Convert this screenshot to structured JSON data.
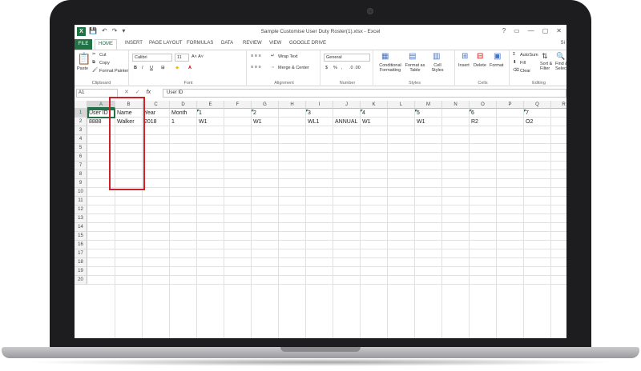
{
  "window": {
    "title": "Sample Customise User Duty Roster(1).xlsx - Excel",
    "app_icon": "X",
    "qat_icons": [
      "save-icon",
      "undo-icon",
      "redo-icon",
      "customize-icon"
    ],
    "controls": [
      "?",
      "▭",
      "—",
      "▢",
      "✕"
    ],
    "sign_in": "Si"
  },
  "tabs": [
    "FILE",
    "HOME",
    "INSERT",
    "PAGE LAYOUT",
    "FORMULAS",
    "DATA",
    "REVIEW",
    "VIEW",
    "GOOGLE DRIVE"
  ],
  "ribbon": {
    "clipboard": {
      "paste": "Paste",
      "cut": "Cut",
      "copy": "Copy",
      "format_painter": "Format Painter",
      "label": "Clipboard"
    },
    "font": {
      "name": "Calibri",
      "size": "11",
      "bold": "B",
      "italic": "I",
      "underline": "U",
      "label": "Font"
    },
    "alignment": {
      "wrap": "Wrap Text",
      "merge": "Merge & Center",
      "label": "Alignment"
    },
    "number": {
      "format": "General",
      "currency": "$",
      "percent": "%",
      "comma": ",",
      "label": "Number"
    },
    "styles": {
      "conditional": "Conditional Formatting",
      "as_table": "Format as Table",
      "cell_styles": "Cell Styles",
      "label": "Styles"
    },
    "cells": {
      "insert": "Insert",
      "delete": "Delete",
      "format": "Format",
      "label": "Cells"
    },
    "editing": {
      "autosum": "AutoSum",
      "fill": "Fill",
      "clear": "Clear",
      "sort": "Sort & Filter",
      "find": "Find & Select",
      "label": "Editing"
    }
  },
  "formula_bar": {
    "name_box": "A1",
    "cancel": "✕",
    "enter": "✓",
    "fx": "fx",
    "content": "User ID"
  },
  "columns": [
    "A",
    "B",
    "C",
    "D",
    "E",
    "F",
    "G",
    "H",
    "I",
    "J",
    "K",
    "L",
    "M",
    "N",
    "O",
    "P",
    "Q",
    "R"
  ],
  "rows": [
    "1",
    "2",
    "3",
    "4",
    "5",
    "6",
    "7",
    "8",
    "9",
    "10",
    "11",
    "12",
    "13",
    "14",
    "15",
    "16",
    "17",
    "18",
    "19",
    "20"
  ],
  "cells": {
    "r1": [
      "User ID",
      "Name",
      "Year",
      "Month",
      "1",
      "2",
      "3",
      "4",
      "5",
      "6",
      "7"
    ],
    "r2": [
      "8888",
      "Walker",
      "2018",
      "1",
      "W1",
      "W1",
      "WL1",
      "ANNUAL",
      "W1",
      "W1",
      "R2",
      "O2"
    ]
  },
  "colors": {
    "excel_green": "#217346",
    "highlight_red": "#d11f2a"
  }
}
